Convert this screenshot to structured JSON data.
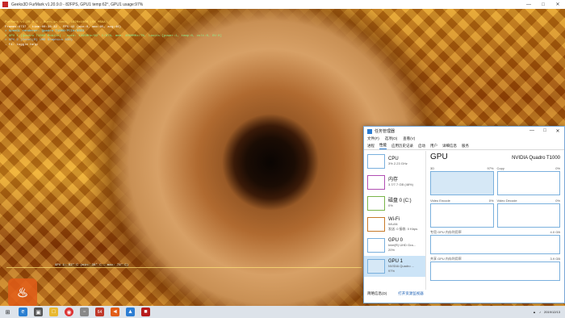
{
  "furmark": {
    "title": "Geeks3D FurMark v1.20.9.0 - 82FPS, GPU1 temp:62°, GPU1 usage:97%",
    "hud_lines": [
      "FurMark v1.20.9.0 - Burn-in test, 1920x1008 (0X MSAA)",
      "Frames:6737 - time:00:38:32 - FPS:42 (min:0, max:85, avg:46)",
      "> OpenGL renderer: Quadro T1000/PCIe/SSE2",
      "> GPU 1 (Quadro T1000 Mobile) - core: 1395MHz/62° C/97%, mem: 4000MHz/7%, limits:[power:1, temp:0, volt:0, OV:0]",
      "> GPU 2 (Intel(R) UHD Graphics 630)",
      "- F1: toggle help"
    ],
    "graph_label": "GPU 1: 62° C (min: 38° C - max: 74° C)",
    "logo_text": "♨"
  },
  "taskmgr": {
    "title": "任务管理器",
    "menu": [
      "文件(F)",
      "选项(O)",
      "查看(V)"
    ],
    "tabs": [
      "进程",
      "性能",
      "应用历史记录",
      "启动",
      "用户",
      "详细信息",
      "服务"
    ],
    "active_tab": "性能",
    "resources": [
      {
        "name": "CPU",
        "sub1": "3% 2.23 GHz",
        "sub2": ""
      },
      {
        "name": "内存",
        "sub1": "3.7/7.7 GB (48%)",
        "sub2": ""
      },
      {
        "name": "磁盘 0 (C:)",
        "sub1": "0%",
        "sub2": ""
      },
      {
        "name": "Wi-Fi",
        "sub1": "WLAN",
        "sub2": "发送: 0 接收: 0 Kbps"
      },
      {
        "name": "GPU 0",
        "sub1": "Intel(R) UHD Gra...",
        "sub2": "20%"
      },
      {
        "name": "GPU 1",
        "sub1": "NVIDIA Quadro ...",
        "sub2": "97%"
      }
    ],
    "gpu_heading": "GPU",
    "gpu_model": "NVIDIA Quadro T1000",
    "engines": [
      {
        "name": "3D",
        "pct": "97%"
      },
      {
        "name": "Copy",
        "pct": "0%"
      },
      {
        "name": "Video Encode",
        "pct": "0%"
      },
      {
        "name": "Video Decode",
        "pct": "0%"
      }
    ],
    "dedicated_label": "专用 GPU 内存利用率",
    "dedicated_max": "4.0 GB",
    "shared_label": "共享 GPU 内存利用率",
    "shared_max": "3.9 GB",
    "footer_less": "简略信息(D)",
    "footer_monitor": "打开资源监视器"
  },
  "watermark": "PConline",
  "taskbar": {
    "icons": [
      "windows-icon",
      "search-icon",
      "edge-icon",
      "store-icon",
      "explorer-icon",
      "chrome-icon",
      "app-icon",
      "aida64-icon",
      "furmark-icon",
      "taskmgr-icon",
      "gpuz-icon"
    ],
    "aida_label": "64",
    "time": "",
    "date": "2019/12/13"
  }
}
